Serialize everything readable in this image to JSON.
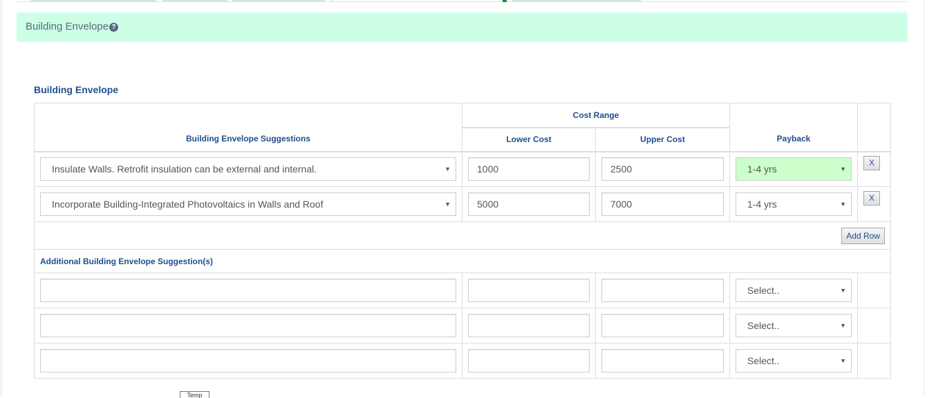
{
  "panel": {
    "title": "Building Envelope",
    "help_icon": "question-circle-icon"
  },
  "section": {
    "title": "Building Envelope"
  },
  "table": {
    "headers": {
      "suggestions": "Building Envelope Suggestions",
      "cost_range": "Cost Range",
      "lower_cost": "Lower Cost",
      "upper_cost": "Upper Cost",
      "payback": "Payback"
    },
    "rows": [
      {
        "suggestion": "Insulate Walls. Retrofit insulation can be external and internal.",
        "lower_cost": "1000",
        "upper_cost": "2500",
        "payback": "1-4 yrs",
        "payback_highlight": "#ccffcc",
        "remove_label": "X"
      },
      {
        "suggestion": "Incorporate Building-Integrated Photovoltaics in Walls and Roof",
        "lower_cost": "5000",
        "upper_cost": "7000",
        "payback": "1-4 yrs",
        "remove_label": "X"
      }
    ],
    "add_row_label": "Add Row",
    "additional_title": "Additional Building Envelope Suggestion(s)",
    "additional_rows": [
      {
        "suggestion": "",
        "lower_cost": "",
        "upper_cost": "",
        "payback": "Select.."
      },
      {
        "suggestion": "",
        "lower_cost": "",
        "upper_cost": "",
        "payback": "Select.."
      },
      {
        "suggestion": "",
        "lower_cost": "",
        "upper_cost": "",
        "payback": "Select.."
      }
    ]
  },
  "tooltip": {
    "text": "Temp"
  },
  "colors": {
    "panel_bg": "#ccffe5",
    "heading_text": "#1f4e8c",
    "highlight_select": "#ccffcc"
  }
}
